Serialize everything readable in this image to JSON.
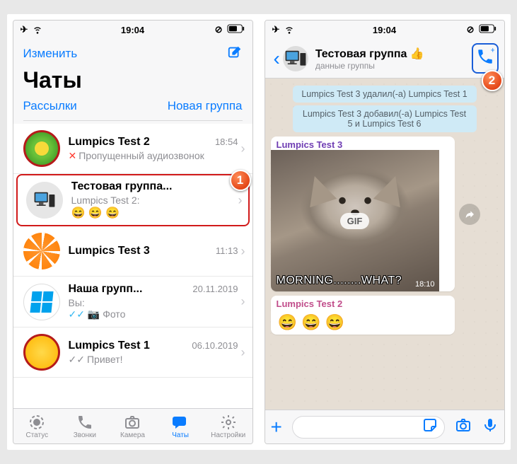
{
  "statusbar": {
    "time": "19:04"
  },
  "left": {
    "edit": "Изменить",
    "title": "Чаты",
    "broadcasts": "Рассылки",
    "newgroup": "Новая группа",
    "chats": [
      {
        "title": "Lumpics Test 2",
        "time": "18:54",
        "preview": "Пропущенный аудиозвонок",
        "missed": true
      },
      {
        "title": "Тестовая группа...",
        "time": "",
        "previewAuthor": "Lumpics Test 2:",
        "previewEmojis": "😄 😄 😄",
        "highlighted": true
      },
      {
        "title": "Lumpics Test 3",
        "time": "11:13",
        "preview": ""
      },
      {
        "title": "Наша групп...",
        "time": "20.11.2019",
        "previewAuthor": "Вы:",
        "preview": "Фото",
        "ticks": true
      },
      {
        "title": "Lumpics Test 1",
        "time": "06.10.2019",
        "preview": "Привет!",
        "ticksGray": true
      }
    ],
    "tabs": {
      "status": "Статус",
      "calls": "Звонки",
      "camera": "Камера",
      "chats": "Чаты",
      "settings": "Настройки"
    }
  },
  "right": {
    "title": "Тестовая группа 👍",
    "subtitle": "данные группы",
    "sys1": "Lumpics Test 3 удалил(-а) Lumpics Test 1",
    "sys2": "Lumpics Test 3 добавил(-а) Lumpics Test 5 и Lumpics Test 6",
    "msg1_sender": "Lumpics Test 3",
    "gif_label": "GIF",
    "gif_caption": "MORNING........WHAT?",
    "gif_time": "18:10",
    "msg2_sender": "Lumpics Test 2",
    "msg2_emojis": "😄 😄 😄"
  },
  "markers": {
    "one": "1",
    "two": "2"
  }
}
